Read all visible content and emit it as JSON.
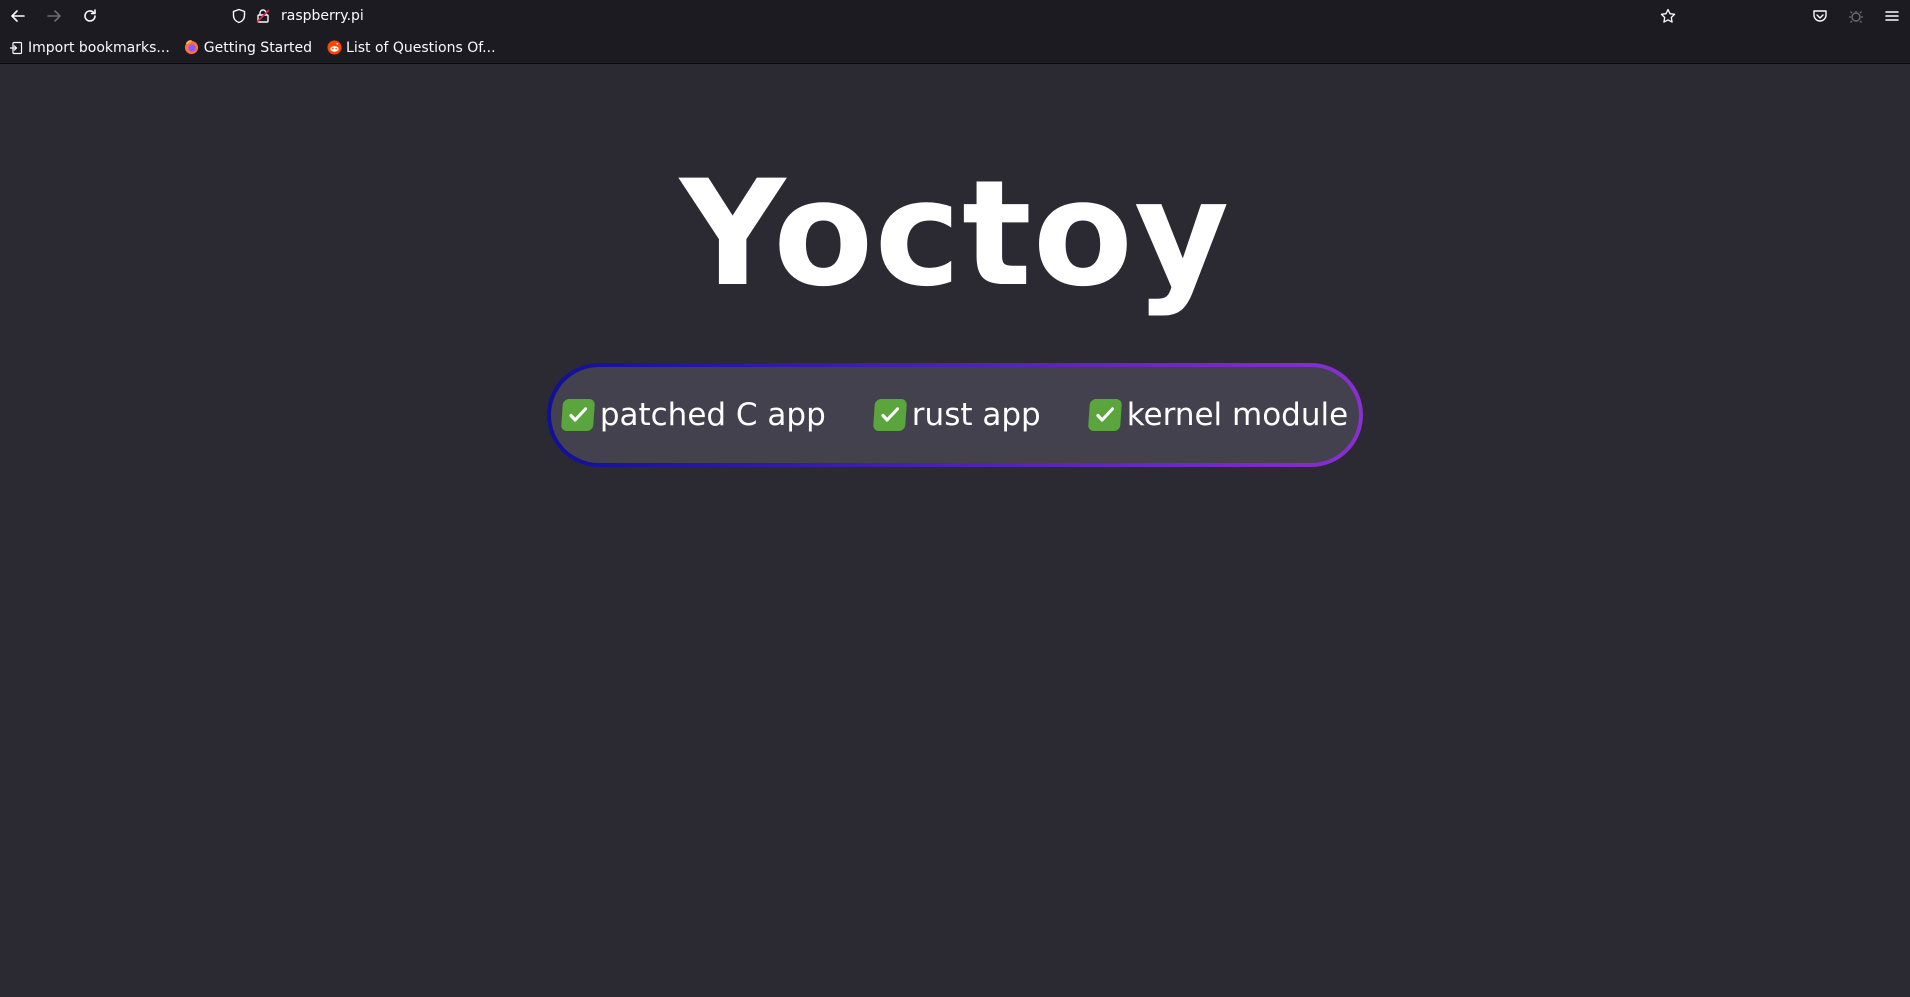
{
  "browser": {
    "url": "raspberry.pi",
    "bookmarks": [
      {
        "label": "Import bookmarks...",
        "icon": "import-icon"
      },
      {
        "label": "Getting Started",
        "icon": "firefox-icon"
      },
      {
        "label": "List of Questions Of...",
        "icon": "reddit-icon"
      }
    ]
  },
  "page": {
    "title": "Yoctoy",
    "status_items": [
      {
        "label": "patched C app",
        "icon": "check-mark-icon"
      },
      {
        "label": "rust app",
        "icon": "check-mark-icon"
      },
      {
        "label": "kernel module",
        "icon": "check-mark-icon"
      }
    ],
    "colors": {
      "background": "#2b2a33",
      "pill_fill": "#42414d",
      "pill_border_start": "#10109a",
      "pill_border_end": "#8a2fd0",
      "check_green": "#5aa53c"
    }
  }
}
